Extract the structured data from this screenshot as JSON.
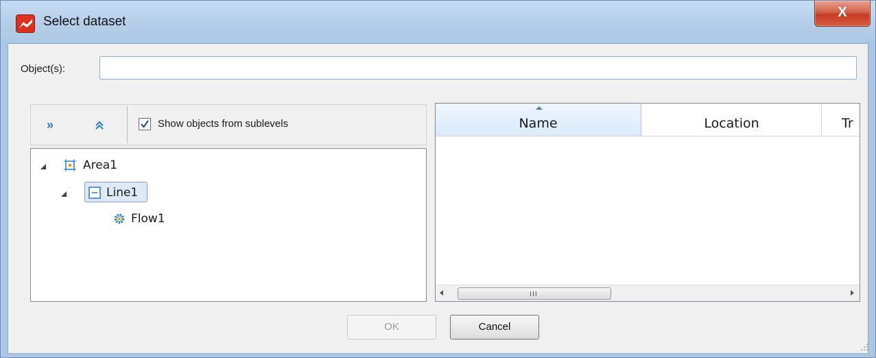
{
  "window": {
    "title": "Select dataset",
    "close_glyph": "X"
  },
  "objects": {
    "label": "Object(s):",
    "value": "",
    "placeholder": ""
  },
  "toolbar": {
    "expand_icon": "»",
    "collapse_icon": "⌃",
    "show_sublevels_label": "Show objects from sublevels",
    "show_sublevels_checked": true
  },
  "tree": {
    "items": [
      {
        "label": "Area1",
        "icon": "area-icon",
        "expanded": true
      },
      {
        "label": "Line1",
        "icon": "line-icon",
        "expanded": true,
        "selected": true
      },
      {
        "label": "Flow1",
        "icon": "flow-gear-icon"
      }
    ]
  },
  "grid": {
    "columns": [
      {
        "label": "Name",
        "sorted": "ascending"
      },
      {
        "label": "Location"
      },
      {
        "label": "Tr"
      }
    ],
    "rows": [],
    "thumb_grip": "III"
  },
  "buttons": {
    "ok": "OK",
    "cancel": "Cancel"
  },
  "colors": {
    "accent": "#2c79c6",
    "app_icon": "#d9321f",
    "close_button": "#c43a22",
    "selection": "#dde9f8"
  }
}
